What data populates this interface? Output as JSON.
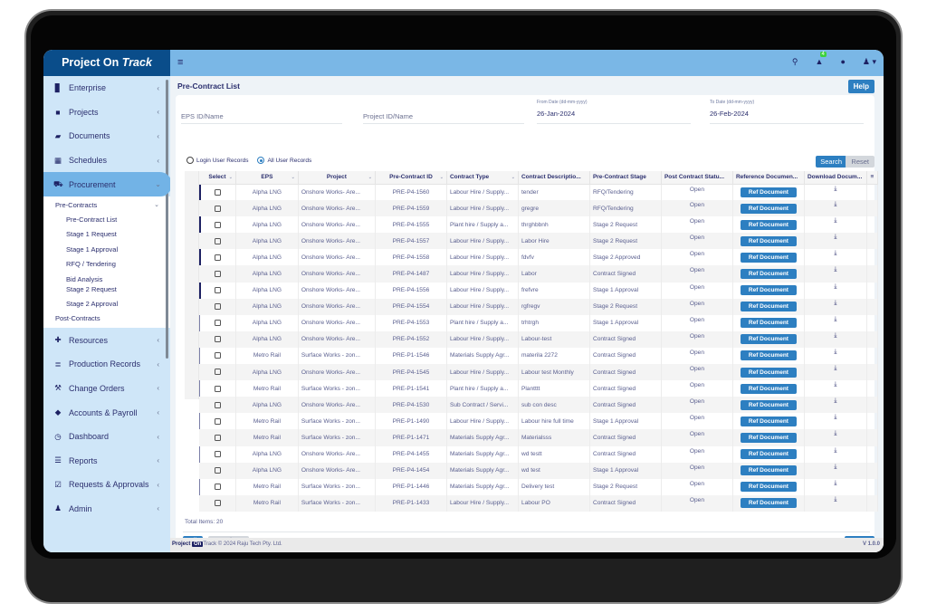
{
  "app": {
    "brand": "Project On",
    "brand_italic": "Track"
  },
  "topbar": {
    "menu_icon": "hamburger-icon",
    "notification_count": "4",
    "icons": [
      "search-icon",
      "bell-icon",
      "info-icon",
      "user-icon"
    ]
  },
  "sidebar": {
    "items": [
      {
        "label": "Enterprise",
        "icon": "building-icon"
      },
      {
        "label": "Projects",
        "icon": "folder-icon"
      },
      {
        "label": "Documents",
        "icon": "folder-open-icon"
      },
      {
        "label": "Schedules",
        "icon": "calendar-icon"
      },
      {
        "label": "Procurement",
        "icon": "cart-icon"
      },
      {
        "label": "Resources",
        "icon": "users-icon"
      },
      {
        "label": "Production Records",
        "icon": "database-icon"
      },
      {
        "label": "Change Orders",
        "icon": "wrench-icon"
      },
      {
        "label": "Accounts & Payroll",
        "icon": "piggy-bank-icon"
      },
      {
        "label": "Dashboard",
        "icon": "gauge-icon"
      },
      {
        "label": "Reports",
        "icon": "list-icon"
      },
      {
        "label": "Requests & Approvals",
        "icon": "check-square-icon"
      },
      {
        "label": "Admin",
        "icon": "user-icon"
      }
    ],
    "submenu": {
      "pre_contracts": "Pre-Contracts",
      "items": [
        "Pre-Contract List",
        "Stage 1 Request",
        "Stage 1 Approval",
        "RFQ / Tendering",
        "Bid Analysis",
        "Stage 2 Request",
        "Stage 2 Approval"
      ],
      "post_contracts": "Post-Contracts"
    }
  },
  "page": {
    "title": "Pre-Contract List",
    "help": "Help"
  },
  "filters": {
    "eps_placeholder": "EPS ID/Name",
    "project_placeholder": "Project ID/Name",
    "from_label": "From Date (dd-mm-yyyy)",
    "from_value": "26-Jan-2024",
    "to_label": "To Date (dd-mm-yyyy)",
    "to_value": "26-Feb-2024",
    "radio_login": "Login User Records",
    "radio_all": "All User Records",
    "selected_radio": "All User Records",
    "search": "Search",
    "reset": "Reset"
  },
  "table": {
    "columns": [
      "Select",
      "EPS",
      "Project",
      "Pre-Contract ID",
      "Contract Type",
      "Contract Descriptio...",
      "Pre-Contract Stage",
      "Post Contract Statu...",
      "Reference Documen...",
      "Download Docum..."
    ],
    "ref_button": "Ref Document",
    "rows": [
      {
        "eps": "Alpha LNG",
        "project": "Onshore Works- Are...",
        "id": "PRE-P4-1560",
        "type": "Labour Hire / Supply...",
        "desc": "tender",
        "stage": "RFQ/Tendering",
        "status": "Open"
      },
      {
        "eps": "Alpha LNG",
        "project": "Onshore Works- Are...",
        "id": "PRE-P4-1559",
        "type": "Labour Hire / Supply...",
        "desc": "gregre",
        "stage": "RFQ/Tendering",
        "status": "Open"
      },
      {
        "eps": "Alpha LNG",
        "project": "Onshore Works- Are...",
        "id": "PRE-P4-1555",
        "type": "Plant hire / Supply a...",
        "desc": "thrghbbnh",
        "stage": "Stage 2 Request",
        "status": "Open"
      },
      {
        "eps": "Alpha LNG",
        "project": "Onshore Works- Are...",
        "id": "PRE-P4-1557",
        "type": "Labour Hire / Supply...",
        "desc": "Labor Hire",
        "stage": "Stage 2 Request",
        "status": "Open"
      },
      {
        "eps": "Alpha LNG",
        "project": "Onshore Works- Are...",
        "id": "PRE-P4-1558",
        "type": "Labour Hire / Supply...",
        "desc": "fdvfv",
        "stage": "Stage 2 Approved",
        "status": "Open"
      },
      {
        "eps": "Alpha LNG",
        "project": "Onshore Works- Are...",
        "id": "PRE-P4-1487",
        "type": "Labour Hire / Supply...",
        "desc": "Labor",
        "stage": "Contract Signed",
        "status": "Open"
      },
      {
        "eps": "Alpha LNG",
        "project": "Onshore Works- Are...",
        "id": "PRE-P4-1556",
        "type": "Labour Hire / Supply...",
        "desc": "frefvre",
        "stage": "Stage 1 Approval",
        "status": "Open"
      },
      {
        "eps": "Alpha LNG",
        "project": "Onshore Works- Are...",
        "id": "PRE-P4-1554",
        "type": "Labour Hire / Supply...",
        "desc": "rgfregv",
        "stage": "Stage 2 Request",
        "status": "Open"
      },
      {
        "eps": "Alpha LNG",
        "project": "Onshore Works- Are...",
        "id": "PRE-P4-1553",
        "type": "Plant hire / Supply a...",
        "desc": "trhtrgh",
        "stage": "Stage 1 Approval",
        "status": "Open"
      },
      {
        "eps": "Alpha LNG",
        "project": "Onshore Works- Are...",
        "id": "PRE-P4-1552",
        "type": "Labour Hire / Supply...",
        "desc": "Labour-test",
        "stage": "Contract Signed",
        "status": "Open"
      },
      {
        "eps": "Metro Rail",
        "project": "Surface Works - zon...",
        "id": "PRE-P1-1546",
        "type": "Materials Supply Agr...",
        "desc": "materila 2272",
        "stage": "Contract Signed",
        "status": "Open"
      },
      {
        "eps": "Alpha LNG",
        "project": "Onshore Works- Are...",
        "id": "PRE-P4-1545",
        "type": "Labour Hire / Supply...",
        "desc": "Labour test Monthly",
        "stage": "Contract Signed",
        "status": "Open"
      },
      {
        "eps": "Metro Rail",
        "project": "Surface Works - zon...",
        "id": "PRE-P1-1541",
        "type": "Plant hire / Supply a...",
        "desc": "Plantttt",
        "stage": "Contract Signed",
        "status": "Open"
      },
      {
        "eps": "Alpha LNG",
        "project": "Onshore Works- Are...",
        "id": "PRE-P4-1530",
        "type": "Sub Contract / Servi...",
        "desc": "sub con desc",
        "stage": "Contract Signed",
        "status": "Open"
      },
      {
        "eps": "Metro Rail",
        "project": "Surface Works - zon...",
        "id": "PRE-P1-1490",
        "type": "Labour Hire / Supply...",
        "desc": "Labour hire full time",
        "stage": "Stage 1 Approval",
        "status": "Open"
      },
      {
        "eps": "Metro Rail",
        "project": "Surface Works - zon...",
        "id": "PRE-P1-1471",
        "type": "Materials Supply Agr...",
        "desc": "Materialsss",
        "stage": "Contract Signed",
        "status": "Open"
      },
      {
        "eps": "Alpha LNG",
        "project": "Onshore Works- Are...",
        "id": "PRE-P4-1455",
        "type": "Materials Supply Agr...",
        "desc": "wd testt",
        "stage": "Contract Signed",
        "status": "Open"
      },
      {
        "eps": "Alpha LNG",
        "project": "Onshore Works- Are...",
        "id": "PRE-P4-1454",
        "type": "Materials Supply Agr...",
        "desc": "wd test",
        "stage": "Stage 1 Approval",
        "status": "Open"
      },
      {
        "eps": "Metro Rail",
        "project": "Surface Works - zon...",
        "id": "PRE-P1-1446",
        "type": "Materials Supply Agr...",
        "desc": "Delivery test",
        "stage": "Stage 2 Request",
        "status": "Open"
      },
      {
        "eps": "Metro Rail",
        "project": "Surface Works - zon...",
        "id": "PRE-P1-1433",
        "type": "Labour Hire / Supply...",
        "desc": "Labour PO",
        "stage": "Contract Signed",
        "status": "Open"
      }
    ],
    "total_items": "Total Items: 20"
  },
  "actions": {
    "edit": "Edit",
    "deactivate": "Deactivate",
    "create": "Create"
  },
  "footer": {
    "brand_left": "Project",
    "brand_on": "On",
    "copyright": "Track © 2024 Raju Tech Pty. Ltd.",
    "version": "V 1.0.0"
  },
  "colors": {
    "brand": "#0a4d8a",
    "topbar": "#7ab7e6",
    "sidebar": "#cfe6f8",
    "primary_button": "#2d7fc1",
    "badge": "#3cd23c"
  }
}
